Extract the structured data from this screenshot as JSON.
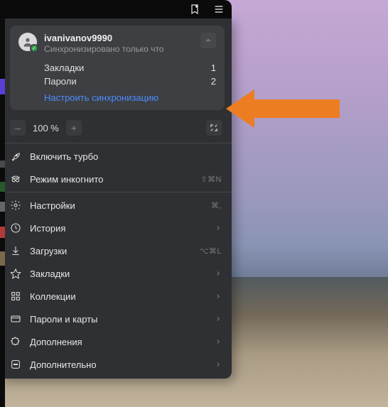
{
  "profile": {
    "name": "ivanivanov9990",
    "status": "Синхронизировано только что"
  },
  "sync": {
    "rows": [
      {
        "label": "Закладки",
        "count": "1"
      },
      {
        "label": "Пароли",
        "count": "2"
      }
    ],
    "configure": "Настроить синхронизацию"
  },
  "zoom": {
    "minus": "–",
    "level": "100 %",
    "plus": "+"
  },
  "menu": {
    "turbo": {
      "label": "Включить турбо"
    },
    "incognito": {
      "label": "Режим инкогнито",
      "hint": "⇧⌘N"
    },
    "settings": {
      "label": "Настройки",
      "hint": "⌘,"
    },
    "history": {
      "label": "История"
    },
    "downloads": {
      "label": "Загрузки",
      "hint": "⌥⌘L"
    },
    "bookmarks": {
      "label": "Закладки"
    },
    "collections": {
      "label": "Коллекции"
    },
    "passwords": {
      "label": "Пароли и карты"
    },
    "addons": {
      "label": "Дополнения"
    },
    "more": {
      "label": "Дополнительно"
    }
  },
  "colors": {
    "arrow": "#ed7d22"
  }
}
